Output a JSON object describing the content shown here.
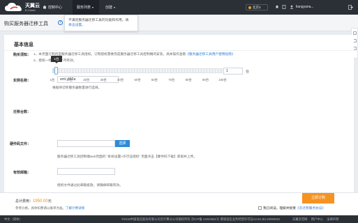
{
  "topbar": {
    "logo_name": "天翼云",
    "logo_sub": "E-Cloud",
    "console": "控制中心",
    "nav": [
      {
        "label": "服务列表",
        "caret": "▾"
      },
      {
        "label": "创建",
        "caret": "▾"
      }
    ],
    "region": "北京3",
    "user": "liangyana...",
    "icons": [
      "home-icon",
      "bell-icon",
      "document-icon",
      "user-icon",
      "logout-icon"
    ]
  },
  "popover": {
    "text": "不满足服务器迁移工具的功能和作用，请",
    "link": "单击设置。"
  },
  "page": {
    "title": "购买服务器迁移工具",
    "help": "?"
  },
  "section": {
    "title": "基本信息"
  },
  "form": {
    "purchase_note_label": "购买须知：",
    "purchase_notes": [
      "1、本页面订购的是服务器迁移工具授权。订购授权需要完成服务器迁移工具控制端的安装。具体操作查看",
      "2、授权一经提供6个月有效。"
    ],
    "purchase_note_link": "《服务器迁移工具用户使用指南》",
    "instance_label": "实例名称：",
    "instance_value": "smt -842a",
    "migrate_label": "迁移台数：",
    "slider": {
      "value": 1,
      "tip": "1台",
      "ticks": [
        "1台",
        "10台",
        "20台",
        "30台",
        "40台",
        "50台",
        "60台",
        "70台",
        "80台",
        "90台",
        "100台"
      ],
      "min": 1,
      "max": 100
    },
    "stepper_value": "1",
    "unit": "台",
    "slider_hint": "根据待迁移服务器数量进行选择。",
    "cert_label": "硬件码文件：",
    "browse_label": "选择",
    "cert_hint": "服务器迁移工具控制端web页面的 “系统设置>许可证授权” 页面点击【硬件码下载】获取并上传。",
    "email_label": "有效邮箱：",
    "email_hint": "授权文件通过此邮箱投放，请确保邮箱有效。"
  },
  "orderbar": {
    "price_label": "总计费用：",
    "price_value": "1950.00",
    "price_unit": "元",
    "price_sub": "参考价格，具体扣费请以账单为准。",
    "price_sub_link": "了解计费详情",
    "agree_text": "我已阅读，理解并接受",
    "agree_link": "《云迁移服务协议》",
    "order_button": "立即订购"
  },
  "footer": {
    "lang": "中文（简体）",
    "copyright": "©2018中国电信股份有限公司云计算分公司版权所有  京ICP备 12022551号  增值电信业务经营许可证A2.B1.B2-20090001",
    "links": [
      "天翼云官网",
      "用户中心",
      "法律声明"
    ]
  },
  "colors": {
    "topbar": "#2b2f36",
    "accent": "#2d8ad8",
    "order": "#f59322"
  }
}
